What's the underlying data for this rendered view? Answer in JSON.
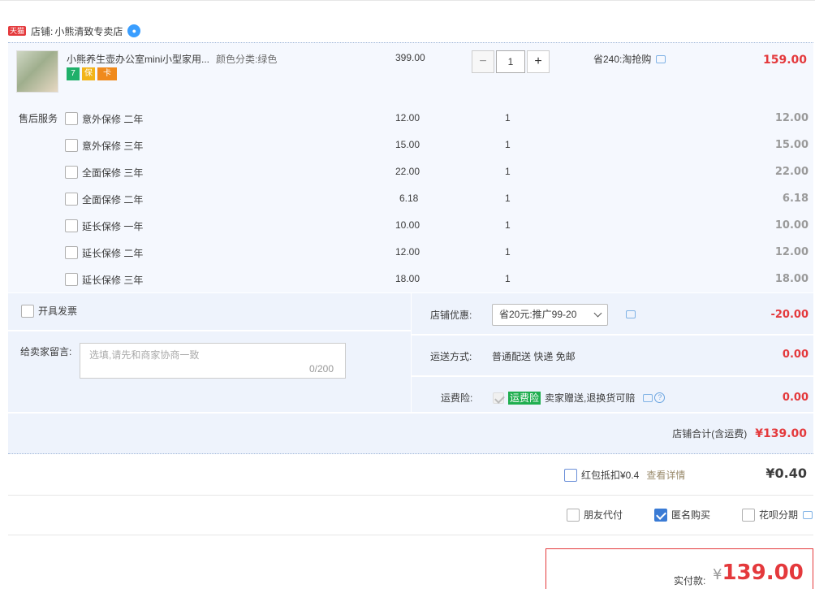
{
  "shop": {
    "badge": "天猫",
    "label": "店铺:",
    "name": "小熊清致专卖店"
  },
  "product": {
    "title": "小熊养生壶办公室mini小型家用...",
    "sku": "颜色分类:绿色",
    "price": "399.00",
    "quantity": "1",
    "promo": "省240:淘抢购",
    "subtotal": "159.00",
    "service_icons": [
      "7",
      "保",
      "卡"
    ]
  },
  "warranty": {
    "title": "售后服务",
    "items": [
      {
        "name": "意外保修 二年",
        "price": "12.00",
        "qty": "1",
        "subtotal": "12.00"
      },
      {
        "name": "意外保修 三年",
        "price": "15.00",
        "qty": "1",
        "subtotal": "15.00"
      },
      {
        "name": "全面保修 三年",
        "price": "22.00",
        "qty": "1",
        "subtotal": "22.00"
      },
      {
        "name": "全面保修 二年",
        "price": "6.18",
        "qty": "1",
        "subtotal": "6.18"
      },
      {
        "name": "延长保修 一年",
        "price": "10.00",
        "qty": "1",
        "subtotal": "10.00"
      },
      {
        "name": "延长保修 二年",
        "price": "12.00",
        "qty": "1",
        "subtotal": "12.00"
      },
      {
        "name": "延长保修 三年",
        "price": "18.00",
        "qty": "1",
        "subtotal": "18.00"
      }
    ]
  },
  "order": {
    "invoice_label": "开具发票",
    "message_label": "给卖家留言:",
    "message_placeholder": "选填,请先和商家协商一致",
    "message_count": "0/200",
    "shop_discount_label": "店铺优惠:",
    "shop_discount_value": "省20元:推广99-20",
    "shop_discount_amount": "-20.00",
    "shipping_label": "运送方式:",
    "shipping_value": "普通配送 快递 免邮",
    "shipping_amount": "0.00",
    "insurance_label": "运费险:",
    "insurance_badge": "运费险",
    "insurance_text": "卖家赠送,退换货可赔",
    "insurance_amount": "0.00",
    "shop_total_label": "店铺合计(含运费)",
    "shop_total_value": "¥139.00"
  },
  "red_packet": {
    "label": "红包抵扣¥0.4",
    "link": "查看详情",
    "value": "¥0.40"
  },
  "options": {
    "friend_pay": "朋友代付",
    "anonymous": "匿名购买",
    "huabei": "花呗分期"
  },
  "payment": {
    "label": "实付款:",
    "currency": "¥",
    "amount": "139.00"
  },
  "colors": {
    "accent_red": "#e4393c",
    "block_bg": "#f5f8fe",
    "order_bg": "#eef3fc",
    "check_blue": "#3a7bd5",
    "insurance_green": "#1fae4f"
  }
}
